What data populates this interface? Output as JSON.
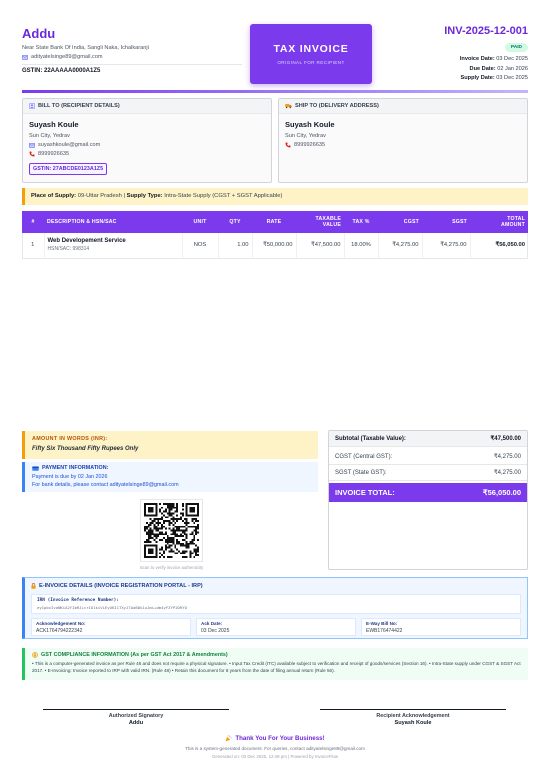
{
  "seller": {
    "name": "Addu",
    "address": "Near State Bank Of India, Sangli Naka, Ichalkaranji",
    "email": "adityatelsinge89@gmail.com",
    "gstin": "GSTIN: 22AAAAA0000A1Z5"
  },
  "title_box": {
    "title": "TAX INVOICE",
    "subtitle": "ORIGINAL FOR RECIPIENT"
  },
  "invoice": {
    "number": "INV-2025-12-001",
    "status": "PAID",
    "invoice_date_label": "Invoice Date:",
    "invoice_date": "03 Dec 2025",
    "due_date_label": "Due Date:",
    "due_date": "02 Jan 2026",
    "supply_date_label": "Supply Date:",
    "supply_date": "03 Dec 2025"
  },
  "bill_to": {
    "heading": "BILL TO (RECIPIENT DETAILS)",
    "name": "Suyash Koule",
    "city": "Sun City, Yedrav",
    "email": "suyashkoule@gmail.com",
    "phone": "8999926635",
    "gstin": "GSTIN: 27ABCDE0123A1Z5"
  },
  "ship_to": {
    "heading": "SHIP TO (DELIVERY ADDRESS)",
    "name": "Suyash Koule",
    "city": "Sun City, Yedrav",
    "phone": "8999926635"
  },
  "supply": {
    "place_label": "Place of Supply:",
    "place_value": "09-Uttar Pradesh",
    "type_label": "Supply Type:",
    "type_value": "Intra-State Supply (CGST + SGST Applicable)"
  },
  "table": {
    "headers": {
      "num": "#",
      "desc": "DESCRIPTION & HSN/SAC",
      "unit": "UNIT",
      "qty": "QTY",
      "rate": "RATE",
      "taxable_1": "TAXABLE",
      "taxable_2": "VALUE",
      "tax": "TAX %",
      "cgst": "CGST",
      "sgst": "SGST",
      "total_1": "TOTAL",
      "total_2": "AMOUNT"
    },
    "rows": [
      {
        "num": "1",
        "desc": "Web Developement Service",
        "hsn": "HSN/SAC: 998314",
        "unit": "NOS",
        "qty": "1.00",
        "rate": "₹50,000.00",
        "taxable": "₹47,500.00",
        "tax": "18.00%",
        "cgst": "₹4,275.00",
        "sgst": "₹4,275.00",
        "total": "₹56,050.00"
      }
    ]
  },
  "amount_words": {
    "label": "AMOUNT IN WORDS (INR):",
    "value": "Fifty Six Thousand Fifty Rupees Only"
  },
  "payment": {
    "label": "PAYMENT INFORMATION:",
    "line1": "Payment is due by 02 Jan 2026",
    "line2": "For bank details, please contact adityatelsinge89@gmail.com"
  },
  "qr": {
    "caption": "Scan to verify invoice authenticity"
  },
  "totals": {
    "subtotal_label": "Subtotal (Taxable Value):",
    "subtotal": "₹47,500.00",
    "cgst_label": "CGST (Central GST):",
    "cgst": "₹4,275.00",
    "sgst_label": "SGST (State GST):",
    "sgst": "₹4,275.00",
    "grand_label": "INVOICE TOTAL:",
    "grand": "₹56,050.00"
  },
  "einvoice": {
    "heading": "E-INVOICE DETAILS (INVOICE REGISTRATION PORTAL - IRP)",
    "irn_label": "IRN (Invoice Reference Number):",
    "irn_value": "ey1pbxIvaNKiA2fIbRJLcrIO1kiVLEyOKI1TXyJTAaBDk1uJmi+dm4yFZYP2DRYO",
    "ack_no_label": "Acknowledgement No:",
    "ack_no": "ACK1764794222342",
    "ack_date_label": "Ack Date:",
    "ack_date": "03 Dec 2025",
    "eway_label": "E-Way Bill No:",
    "eway": "EWB176474422"
  },
  "gst_compliance": {
    "heading": "GST COMPLIANCE INFORMATION (As per GST Act 2017 & Amendments)",
    "body": "• This is a computer-generated invoice as per Rule 46 and does not require a physical signature. • Input Tax Credit (ITC) available subject to verification and receipt of goods/services (Section 16). • Intra-State supply under CGST & SGST Act 2017. • E-Invoicing: Invoice reported to IRP with valid IRN. (Rule 48) • Retain this document for 8 years from the date of filing annual return (Rule 56)."
  },
  "signatures": {
    "left_label": "Authorized Signatory",
    "left_name": "Addu",
    "right_label": "Recipient Acknowledgement",
    "right_name": "Suyash Koule"
  },
  "footer": {
    "thanks": "Thank You For Your Business!",
    "line1": "This is a system-generated document. For queries, contact adityatelsinge89@gmail.com",
    "line2": "Generated on: 03 Dec 2025, 12:49 pm | Powered by InvoiceFlow"
  },
  "colors": {
    "brand": "#7c3aed",
    "paid": "#047857",
    "warning_accent": "#f59e0b",
    "info_accent": "#3b82f6",
    "success_accent": "#22c55e"
  },
  "icons": {
    "email": "email-icon",
    "phone": "phone-icon",
    "bill_to": "user-icon",
    "ship_to": "truck-icon",
    "payment": "card-icon",
    "einvoice": "lock-icon",
    "gst": "info-icon",
    "thanks": "party-icon"
  }
}
